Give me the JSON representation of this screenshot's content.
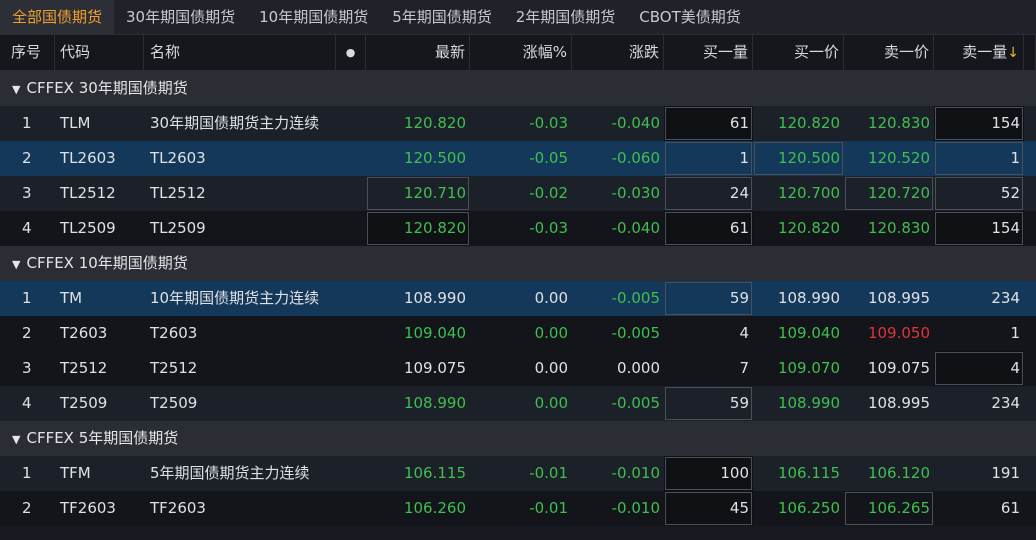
{
  "tabs": [
    {
      "label": "全部国债期货",
      "active": true
    },
    {
      "label": "30年期国债期货"
    },
    {
      "label": "10年期国债期货"
    },
    {
      "label": "5年期国债期货"
    },
    {
      "label": "2年期国债期货"
    },
    {
      "label": "CBOT美债期货"
    }
  ],
  "columns": {
    "idx": "序号",
    "code": "代码",
    "name": "名称",
    "dot": "●",
    "last": "最新",
    "pct": "涨幅%",
    "chg": "涨跌",
    "bid_qty": "买一量",
    "bid": "买一价",
    "ask": "卖一价",
    "ask_qty": "卖一量",
    "sort_icon": "↓"
  },
  "groups": [
    {
      "title": "CFFEX 30年期国债期货",
      "rows": [
        {
          "idx": "1",
          "code": "TLM",
          "name": "30年期国债期货主力连续",
          "last": "120.820",
          "pct": "-0.03",
          "chg": "-0.040",
          "bid_qty": "61",
          "bid": "120.820",
          "ask": "120.830",
          "ask_qty": "154"
        },
        {
          "idx": "2",
          "code": "TL2603",
          "name": "TL2603",
          "last": "120.500",
          "pct": "-0.05",
          "chg": "-0.060",
          "bid_qty": "1",
          "bid": "120.500",
          "ask": "120.520",
          "ask_qty": "1"
        },
        {
          "idx": "3",
          "code": "TL2512",
          "name": "TL2512",
          "last": "120.710",
          "pct": "-0.02",
          "chg": "-0.030",
          "bid_qty": "24",
          "bid": "120.700",
          "ask": "120.720",
          "ask_qty": "52"
        },
        {
          "idx": "4",
          "code": "TL2509",
          "name": "TL2509",
          "last": "120.820",
          "pct": "-0.03",
          "chg": "-0.040",
          "bid_qty": "61",
          "bid": "120.820",
          "ask": "120.830",
          "ask_qty": "154"
        }
      ]
    },
    {
      "title": "CFFEX 10年期国债期货",
      "rows": [
        {
          "idx": "1",
          "code": "TM",
          "name": "10年期国债期货主力连续",
          "last": "108.990",
          "pct": "0.00",
          "chg": "-0.005",
          "bid_qty": "59",
          "bid": "108.990",
          "ask": "108.995",
          "ask_qty": "234"
        },
        {
          "idx": "2",
          "code": "T2603",
          "name": "T2603",
          "last": "109.040",
          "pct": "0.00",
          "chg": "-0.005",
          "bid_qty": "4",
          "bid": "109.040",
          "ask": "109.050",
          "ask_qty": "1"
        },
        {
          "idx": "3",
          "code": "T2512",
          "name": "T2512",
          "last": "109.075",
          "pct": "0.00",
          "chg": "0.000",
          "bid_qty": "7",
          "bid": "109.070",
          "ask": "109.075",
          "ask_qty": "4"
        },
        {
          "idx": "4",
          "code": "T2509",
          "name": "T2509",
          "last": "108.990",
          "pct": "0.00",
          "chg": "-0.005",
          "bid_qty": "59",
          "bid": "108.990",
          "ask": "108.995",
          "ask_qty": "234"
        }
      ]
    },
    {
      "title": "CFFEX 5年期国债期货",
      "rows": [
        {
          "idx": "1",
          "code": "TFM",
          "name": "5年期国债期货主力连续",
          "last": "106.115",
          "pct": "-0.01",
          "chg": "-0.010",
          "bid_qty": "100",
          "bid": "106.115",
          "ask": "106.120",
          "ask_qty": "191"
        },
        {
          "idx": "2",
          "code": "TF2603",
          "name": "TF2603",
          "last": "106.260",
          "pct": "-0.01",
          "chg": "-0.010",
          "bid_qty": "45",
          "bid": "106.250",
          "ask": "106.265",
          "ask_qty": "61"
        }
      ]
    }
  ],
  "colors": {
    "up": "#e0333a",
    "down": "#3fbf4f",
    "flat": "#dfe1e4",
    "accent": "#f0a030"
  }
}
